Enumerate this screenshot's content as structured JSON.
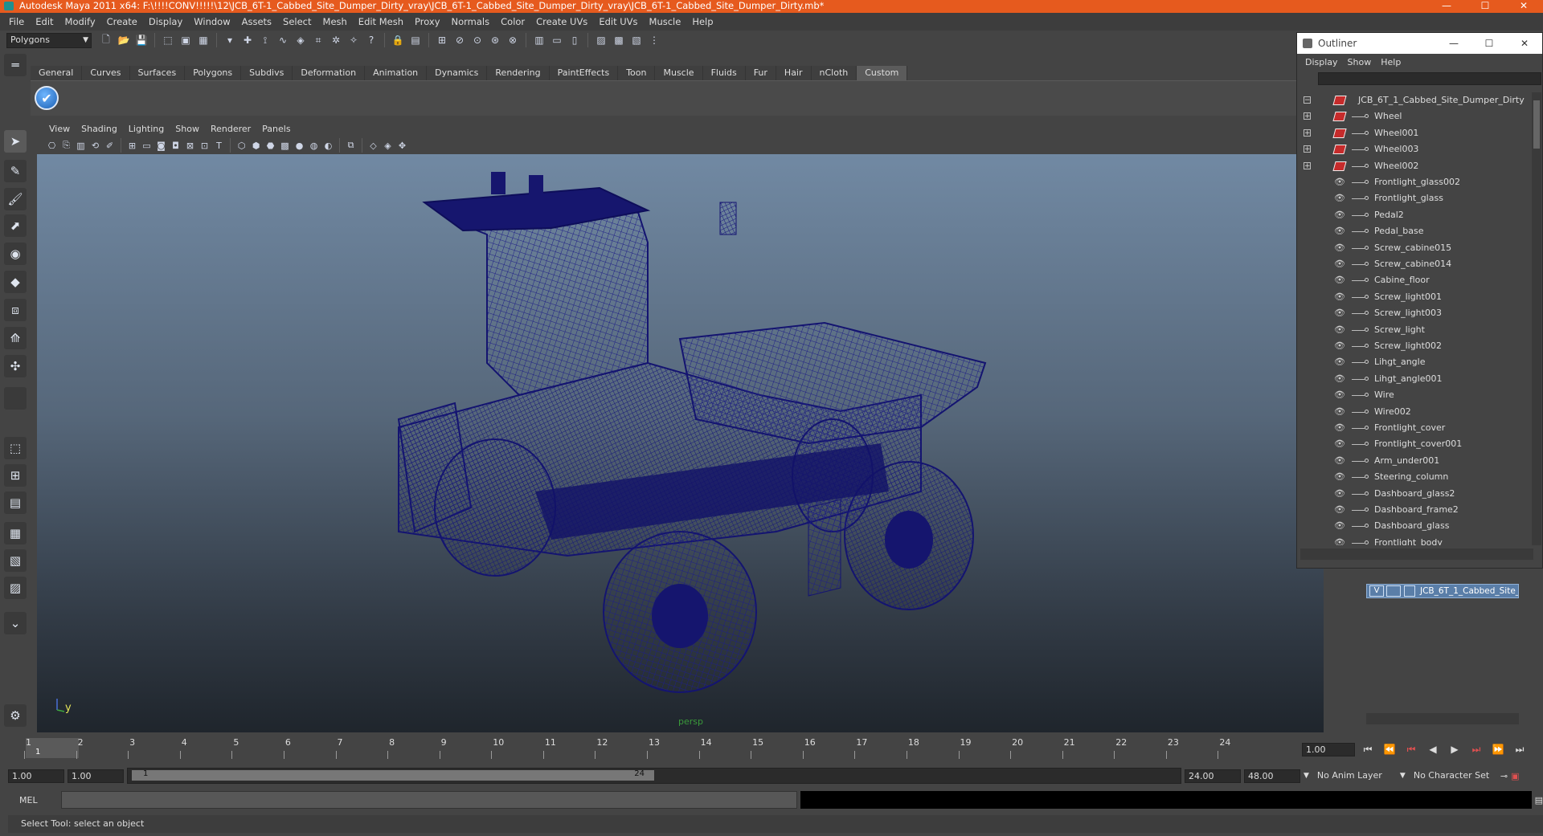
{
  "window": {
    "title": "Autodesk Maya 2011 x64: F:\\!!!!CONV!!!!!\\12\\JCB_6T-1_Cabbed_Site_Dumper_Dirty_vray\\JCB_6T-1_Cabbed_Site_Dumper_Dirty_vray\\JCB_6T-1_Cabbed_Site_Dumper_Dirty.mb*",
    "controls": [
      "—",
      "☐",
      "✕"
    ]
  },
  "menubar": [
    "File",
    "Edit",
    "Modify",
    "Create",
    "Display",
    "Window",
    "Assets",
    "Select",
    "Mesh",
    "Edit Mesh",
    "Proxy",
    "Normals",
    "Color",
    "Create UVs",
    "Edit UVs",
    "Muscle",
    "Help"
  ],
  "statusline": {
    "mode": "Polygons"
  },
  "shelf": {
    "tabs": [
      "General",
      "Curves",
      "Surfaces",
      "Polygons",
      "Subdivs",
      "Deformation",
      "Animation",
      "Dynamics",
      "Rendering",
      "PaintEffects",
      "Toon",
      "Muscle",
      "Fluids",
      "Fur",
      "Hair",
      "nCloth",
      "Custom"
    ],
    "active_tab": "Custom"
  },
  "viewport": {
    "menu": [
      "View",
      "Shading",
      "Lighting",
      "Show",
      "Renderer",
      "Panels"
    ],
    "camera_label": "persp",
    "axis_y": "y",
    "wire_color": "#1a1a7a"
  },
  "outliner": {
    "title": "Outliner",
    "controls": [
      "—",
      "☐",
      "✕"
    ],
    "menu": [
      "Display",
      "Show",
      "Help"
    ],
    "root": "JCB_6T_1_Cabbed_Site_Dumper_Dirty",
    "groups": [
      "Wheel",
      "Wheel001",
      "Wheel003",
      "Wheel002"
    ],
    "meshes": [
      "Frontlight_glass002",
      "Frontlight_glass",
      "Pedal2",
      "Pedal_base",
      "Screw_cabine015",
      "Screw_cabine014",
      "Cabine_floor",
      "Screw_light001",
      "Screw_light003",
      "Screw_light",
      "Screw_light002",
      "Lihgt_angle",
      "Lihgt_angle001",
      "Wire",
      "Wire002",
      "Frontlight_cover",
      "Frontlight_cover001",
      "Arm_under001",
      "Steering_column",
      "Dashboard_glass2",
      "Dashboard_frame2",
      "Dashboard_glass",
      "Frontlight_body"
    ]
  },
  "layers": {
    "visible_flag": "V",
    "layer_name": "JCB_6T_1_Cabbed_Site_"
  },
  "timeline": {
    "ticks": [
      "1",
      "2",
      "3",
      "4",
      "5",
      "6",
      "7",
      "8",
      "9",
      "10",
      "11",
      "12",
      "13",
      "14",
      "15",
      "16",
      "17",
      "18",
      "19",
      "20",
      "21",
      "22",
      "23",
      "24"
    ],
    "current_frame": "1",
    "current_time_field": "1.00"
  },
  "range": {
    "start_time": "1.00",
    "playback_start": "1.00",
    "range_start": "1",
    "range_end": "24",
    "playback_end": "24.00",
    "end_time": "48.00",
    "anim_layer": "No Anim Layer",
    "character_set": "No Character Set"
  },
  "command": {
    "label": "MEL"
  },
  "help_line": "Select Tool: select an object"
}
